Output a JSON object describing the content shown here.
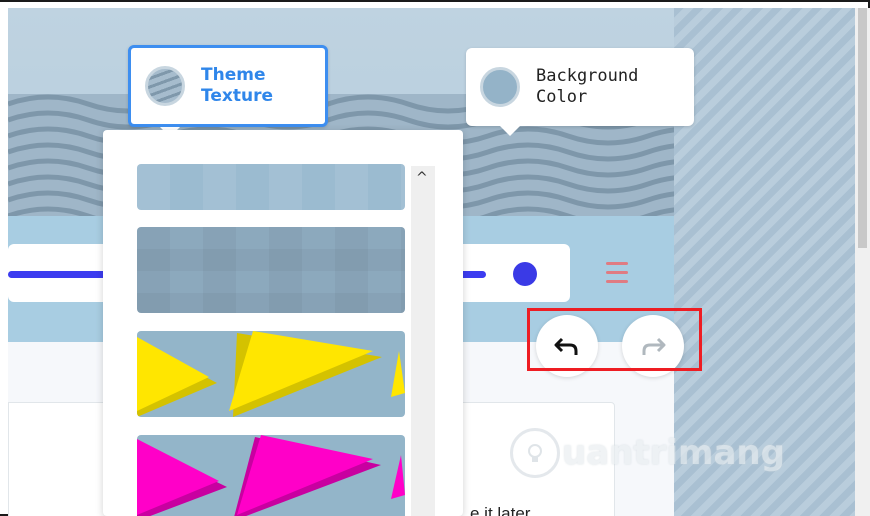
{
  "popovers": {
    "theme_texture": {
      "label": "Theme\nTexture",
      "selected": true
    },
    "background_color": {
      "label": "Background\nColor",
      "selected": false
    }
  },
  "texture_panel": {
    "scroll_up_symbol": "^",
    "tiles": [
      "light-blue-texture",
      "blue-gray-texture",
      "yellow-triangles-texture",
      "magenta-triangles-texture"
    ]
  },
  "history_controls": {
    "undo_icon": "undo-arrow-icon",
    "redo_icon": "redo-arrow-icon"
  },
  "background_page": {
    "partial_text": "e it later"
  },
  "watermark": {
    "text": "uantrimang",
    "logo_letter": "Q"
  },
  "colors": {
    "accent": "#3d8ef0",
    "highlight_box": "#ee1d23",
    "nav_line": "#3c3cf0",
    "yellow": "#ffe600",
    "magenta": "#ff00c8"
  }
}
